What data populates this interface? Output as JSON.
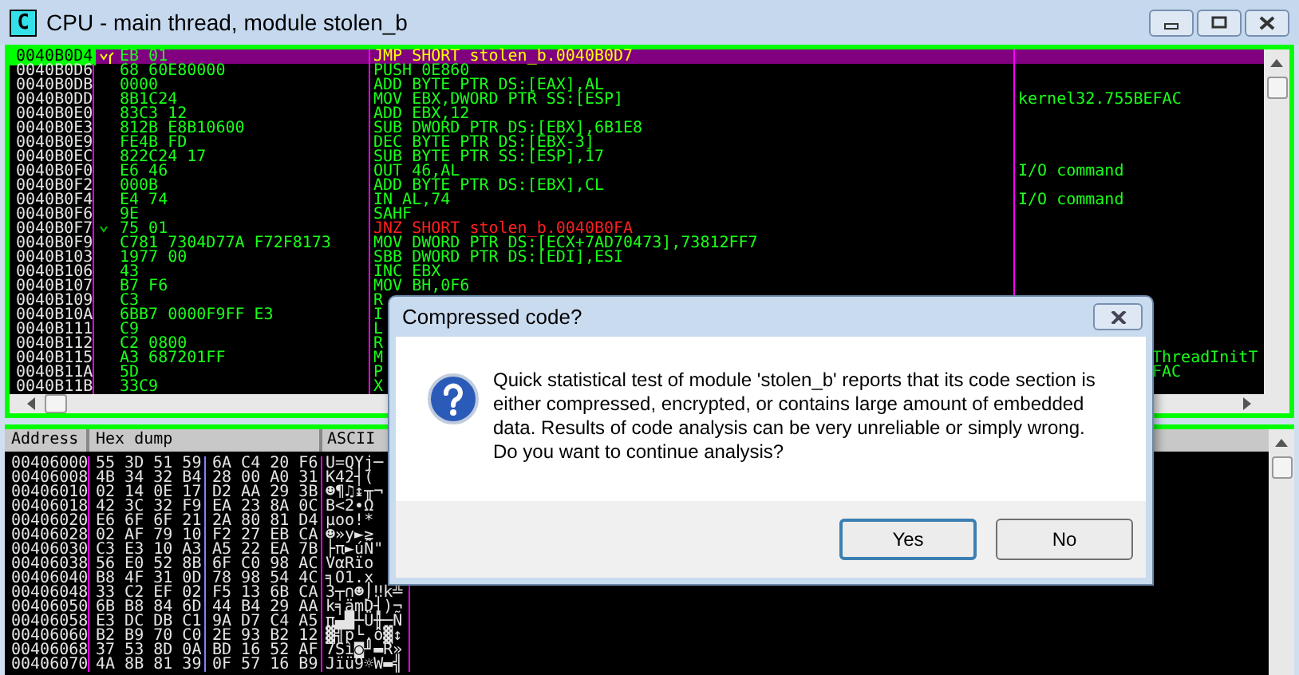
{
  "window": {
    "title": "CPU - main thread, module stolen_b",
    "icon_letter": "C"
  },
  "disassembly": {
    "rows": [
      {
        "address": "0040B0D4",
        "hex": "EB 01",
        "command": "JMP SHORT stolen_b.0040B0D7",
        "kind": "jmp",
        "selected": true,
        "jump_marker": true
      },
      {
        "address": "0040B0D6",
        "hex": "68 60E80000",
        "command": "PUSH 0E860",
        "kind": "other",
        "selected": false,
        "jump_marker": false
      },
      {
        "address": "0040B0DB",
        "hex": "0000",
        "command": "ADD BYTE PTR DS:[EAX],AL",
        "kind": "other",
        "selected": false,
        "jump_marker": false
      },
      {
        "address": "0040B0DD",
        "hex": "8B1C24",
        "command": "MOV EBX,DWORD PTR SS:[ESP]",
        "comment": "kernel32.755BEFAC",
        "kind": "other",
        "selected": false,
        "jump_marker": false
      },
      {
        "address": "0040B0E0",
        "hex": "83C3 12",
        "command": "ADD EBX,12",
        "kind": "other",
        "selected": false,
        "jump_marker": false
      },
      {
        "address": "0040B0E3",
        "hex": "812B E8B10600",
        "command": "SUB DWORD PTR DS:[EBX],6B1E8",
        "kind": "other",
        "selected": false,
        "jump_marker": false
      },
      {
        "address": "0040B0E9",
        "hex": "FE4B FD",
        "command": "DEC BYTE PTR DS:[EBX-3]",
        "kind": "other",
        "selected": false,
        "jump_marker": false
      },
      {
        "address": "0040B0EC",
        "hex": "822C24 17",
        "command": "SUB BYTE PTR SS:[ESP],17",
        "kind": "other",
        "selected": false,
        "jump_marker": false
      },
      {
        "address": "0040B0F0",
        "hex": "E6 46",
        "command": "OUT 46,AL",
        "comment": "I/O command",
        "kind": "other",
        "selected": false,
        "jump_marker": false
      },
      {
        "address": "0040B0F2",
        "hex": "000B",
        "command": "ADD BYTE PTR DS:[EBX],CL",
        "kind": "other",
        "selected": false,
        "jump_marker": false
      },
      {
        "address": "0040B0F4",
        "hex": "E4 74",
        "command": "IN AL,74",
        "comment": "I/O command",
        "kind": "other",
        "selected": false,
        "jump_marker": false
      },
      {
        "address": "0040B0F6",
        "hex": "9E",
        "command": "SAHF",
        "kind": "other",
        "selected": false,
        "jump_marker": false
      },
      {
        "address": "0040B0F7",
        "hex": "75 01",
        "command": "JNZ SHORT stolen_b.0040B0FA",
        "kind": "jcc",
        "selected": false,
        "jump_marker": true
      },
      {
        "address": "0040B0F9",
        "hex": "C781 7304D77A F72F8173",
        "command": "MOV DWORD PTR DS:[ECX+7AD70473],73812FF7",
        "kind": "other",
        "selected": false,
        "jump_marker": false
      },
      {
        "address": "0040B103",
        "hex": "1977 00",
        "command": "SBB DWORD PTR DS:[EDI],ESI",
        "kind": "other",
        "selected": false,
        "jump_marker": false
      },
      {
        "address": "0040B106",
        "hex": "43",
        "command": "INC EBX",
        "kind": "other",
        "selected": false,
        "jump_marker": false
      },
      {
        "address": "0040B107",
        "hex": "B7 F6",
        "command": "MOV BH,0F6",
        "kind": "other",
        "selected": false,
        "jump_marker": false
      },
      {
        "address": "0040B109",
        "hex": "C3",
        "command": "R",
        "kind": "other",
        "selected": false,
        "jump_marker": false
      },
      {
        "address": "0040B10A",
        "hex": "6BB7 0000F9FF E3",
        "command": "I",
        "kind": "other",
        "selected": false,
        "jump_marker": false
      },
      {
        "address": "0040B111",
        "hex": "C9",
        "command": "L",
        "kind": "other",
        "selected": false,
        "jump_marker": false
      },
      {
        "address": "0040B112",
        "hex": "C2 0800",
        "command": "R",
        "kind": "other",
        "selected": false,
        "jump_marker": false
      },
      {
        "address": "0040B115",
        "hex": "A3 687201FF",
        "command": "M",
        "comment": "ThreadInitT",
        "comment_cut": true,
        "kind": "other",
        "selected": false,
        "jump_marker": false
      },
      {
        "address": "0040B11A",
        "hex": "5D",
        "command": "P",
        "comment": "FAC",
        "comment_cut": true,
        "kind": "other",
        "selected": false,
        "jump_marker": false
      },
      {
        "address": "0040B11B",
        "hex": "33C9",
        "command": "X",
        "kind": "other",
        "selected": false,
        "jump_marker": false
      }
    ]
  },
  "dump": {
    "columns": [
      "Address",
      "Hex dump",
      "ASCII"
    ],
    "rows": [
      {
        "address": "00406000",
        "hex": [
          "55 3D 51 59",
          "6A C4 20 F6"
        ],
        "ascii": "U=QYj─"
      },
      {
        "address": "00406008",
        "hex": [
          "4B 34 32 B4",
          "28 00 A0 31"
        ],
        "ascii": "K42┤("
      },
      {
        "address": "00406010",
        "hex": [
          "02 14 0E 17",
          "D2 AA 29 3B"
        ],
        "ascii": "☻¶♫↨╥¬"
      },
      {
        "address": "00406018",
        "hex": [
          "42 3C 32 F9",
          "EA 23 8A 0C"
        ],
        "ascii": "B<2∙Ω"
      },
      {
        "address": "00406020",
        "hex": [
          "E6 6F 6F 21",
          "2A 80 81 D4"
        ],
        "ascii": "µoo!*"
      },
      {
        "address": "00406028",
        "hex": [
          "02 AF 79 10",
          "F2 27 EB CA"
        ],
        "ascii": "☻»y►≥"
      },
      {
        "address": "00406030",
        "hex": [
          "C3 E3 10 A3",
          "A5 22 EA 7B"
        ],
        "ascii": "├π►úÑ\""
      },
      {
        "address": "00406038",
        "hex": [
          "56 E0 52 8B",
          "6F C0 98 AC"
        ],
        "ascii": "VαRïo"
      },
      {
        "address": "00406040",
        "hex": [
          "B8 4F 31 0D",
          "78 98 54 4C"
        ],
        "ascii": "╕O1.x"
      },
      {
        "address": "00406048",
        "hex": [
          "33 C2 EF 02",
          "F5 13 6B CA"
        ],
        "ascii": "3┬∩☻⌡‼k╩"
      },
      {
        "address": "00406050",
        "hex": [
          "6B B8 84 6D",
          "44 B4 29 AA"
        ],
        "ascii": "k╕ämD┤)¬"
      },
      {
        "address": "00406058",
        "hex": [
          "E3 DC DB C1",
          "9A D7 C4 A5"
        ],
        "ascii": "π▄█┴Ü╫─Ñ"
      },
      {
        "address": "00406060",
        "hex": [
          "B2 B9 70 C0",
          "2E 93 B2 12"
        ],
        "ascii": "▓╣p└.ô▓↕"
      },
      {
        "address": "00406068",
        "hex": [
          "37 53 8D 0A",
          "BD 16 52 AF"
        ],
        "ascii": "7Sì◙╜▬R»"
      },
      {
        "address": "00406070",
        "hex": [
          "4A 8B 81 39",
          "0F 57 16 B9"
        ],
        "ascii": "Jïü9☼W▬╣"
      }
    ]
  },
  "dialog": {
    "title": "Compressed code?",
    "message": "Quick statistical test of module 'stolen_b' reports that its code section is either compressed, encrypted, or contains large amount of embedded data. Results of code analysis can be very unreliable or simply wrong. Do you want to continue analysis?",
    "buttons": [
      {
        "label": "Yes",
        "selected": true
      },
      {
        "label": "No",
        "selected": false
      }
    ]
  }
}
